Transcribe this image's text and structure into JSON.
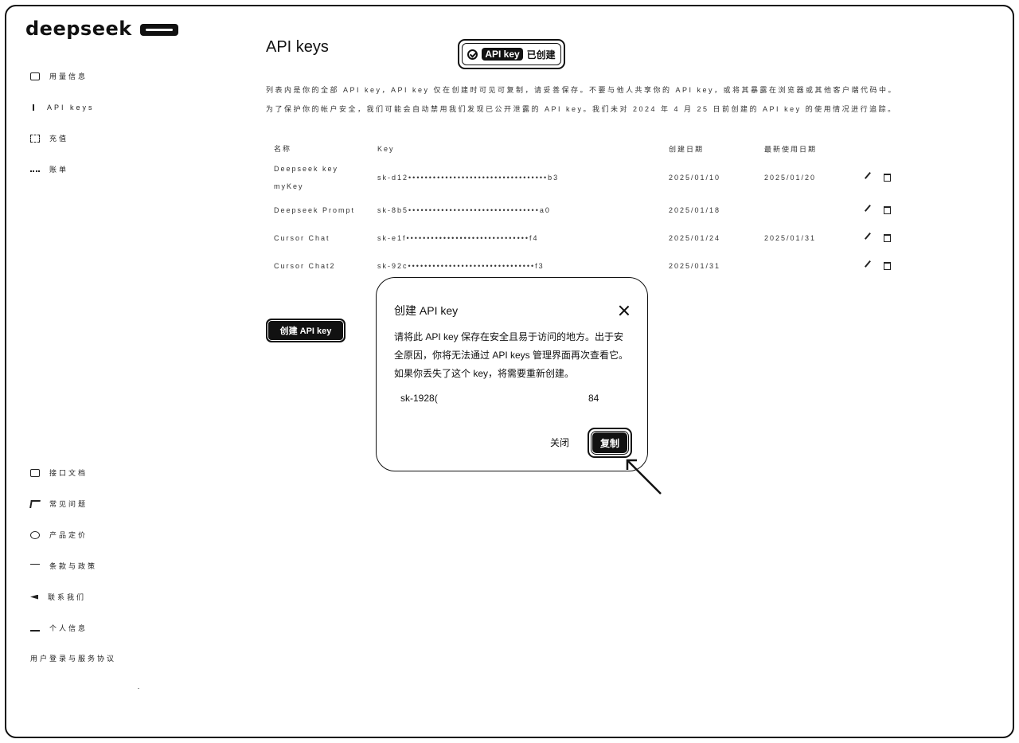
{
  "brand": {
    "name": "deepseek"
  },
  "sidebar": {
    "top_items": [
      {
        "label": "用量信息",
        "icon": "chart-icon"
      },
      {
        "label": "API keys",
        "icon": "key-icon"
      },
      {
        "label": "充值",
        "icon": "wallet-icon"
      },
      {
        "label": "账单",
        "icon": "bill-icon"
      }
    ],
    "bottom_items": [
      {
        "label": "接口文档",
        "icon": "doc-icon"
      },
      {
        "label": "常见问题",
        "icon": "question-icon"
      },
      {
        "label": "产品定价",
        "icon": "price-icon"
      },
      {
        "label": "条款与政策",
        "icon": "policy-icon"
      },
      {
        "label": "联系我们",
        "icon": "contact-icon"
      },
      {
        "label": "个人信息",
        "icon": "user-icon"
      }
    ],
    "footer": "用户登录与服务协议"
  },
  "main": {
    "title": "API keys",
    "toast": {
      "pill": "API key",
      "text": "已创建"
    },
    "description": [
      "列表内是你的全部 API key，API key 仅在创建时可见可复制，请妥善保存。不要与他人共享你的 API key，或将其暴露在浏览器或其他客户端代码中。",
      "为了保护你的帐户安全，我们可能会自动禁用我们发现已公开泄露的 API key。我们未对 2024 年 4 月 25 日前创建的 API key 的使用情况进行追踪。"
    ],
    "table": {
      "headers": {
        "name": "名称",
        "key": "Key",
        "created": "创建日期",
        "used": "最新使用日期"
      },
      "rows": [
        {
          "name": "Deepseek key myKey",
          "key": "sk-d12••••••••••••••••••••••••••••••••••b3",
          "created": "2025/01/10",
          "used": "2025/01/20"
        },
        {
          "name": "Deepseek Prompt",
          "key": "sk-8b5••••••••••••••••••••••••••••••••a0",
          "created": "2025/01/18",
          "used": ""
        },
        {
          "name": "Cursor Chat",
          "key": "sk-e1f••••••••••••••••••••••••••••••f4",
          "created": "2025/01/24",
          "used": "2025/01/31"
        },
        {
          "name": "Cursor Chat2",
          "key": "sk-92c•••••••••••••••••••••••••••••••f3",
          "created": "2025/01/31",
          "used": ""
        }
      ]
    },
    "create_button": "创建 API key"
  },
  "modal": {
    "title": "创建 API key",
    "body": "请将此 API key 保存在安全且易于访问的地方。出于安全原因，你将无法通过 API keys 管理界面再次查看它。如果你丢失了这个 key，将需要重新创建。",
    "key_start": "sk-1928(",
    "key_end": "84",
    "close_label": "关闭",
    "copy_label": "复制"
  }
}
